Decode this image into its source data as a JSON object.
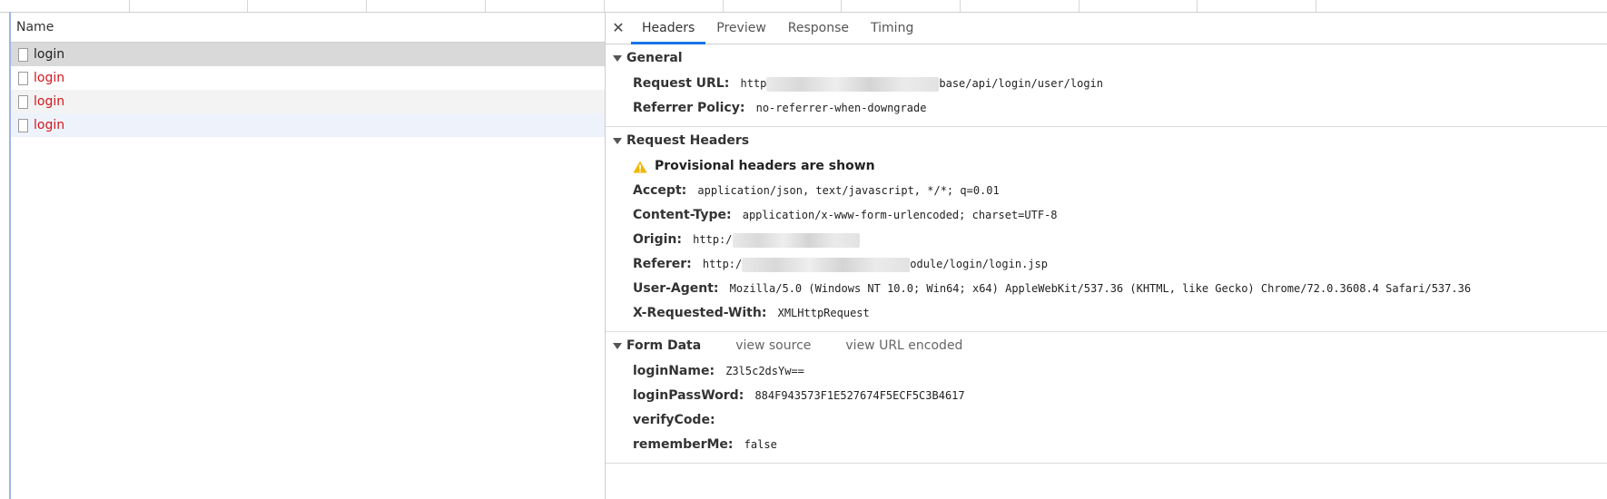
{
  "left_pane": {
    "column_header": "Name",
    "requests": [
      {
        "name": "login",
        "state": "selected"
      },
      {
        "name": "login",
        "state": "error"
      },
      {
        "name": "login",
        "state": "error"
      },
      {
        "name": "login",
        "state": "error"
      }
    ]
  },
  "tabs": {
    "close": "✕",
    "items": [
      "Headers",
      "Preview",
      "Response",
      "Timing"
    ],
    "active": "Headers"
  },
  "general": {
    "title": "General",
    "request_url_key": "Request URL:",
    "request_url_prefix": "http",
    "request_url_suffix": "base/api/login/user/login",
    "referrer_policy_key": "Referrer Policy:",
    "referrer_policy_value": "no-referrer-when-downgrade"
  },
  "request_headers": {
    "title": "Request Headers",
    "warning": "Provisional headers are shown",
    "accept_key": "Accept:",
    "accept_value": "application/json, text/javascript, */*; q=0.01",
    "content_type_key": "Content-Type:",
    "content_type_value": "application/x-www-form-urlencoded; charset=UTF-8",
    "origin_key": "Origin:",
    "origin_prefix": "http:/",
    "referer_key": "Referer:",
    "referer_prefix": "http:/",
    "referer_suffix": "odule/login/login.jsp",
    "user_agent_key": "User-Agent:",
    "user_agent_value": "Mozilla/5.0 (Windows NT 10.0; Win64; x64) AppleWebKit/537.36 (KHTML, like Gecko) Chrome/72.0.3608.4 Safari/537.36",
    "x_requested_with_key": "X-Requested-With:",
    "x_requested_with_value": "XMLHttpRequest"
  },
  "form_data": {
    "title": "Form Data",
    "view_source": "view source",
    "view_url_encoded": "view URL encoded",
    "login_name_key": "loginName:",
    "login_name_value": "Z3l5c2dsYw==",
    "login_password_key": "loginPassWord:",
    "login_password_value": "884F943573F1E527674F5ECF5C3B4617",
    "verify_code_key": "verifyCode:",
    "verify_code_value": "",
    "remember_me_key": "rememberMe:",
    "remember_me_value": "false"
  },
  "colors": {
    "accent": "#1a73e8",
    "error": "#d4161c",
    "warning": "#f2b600"
  }
}
